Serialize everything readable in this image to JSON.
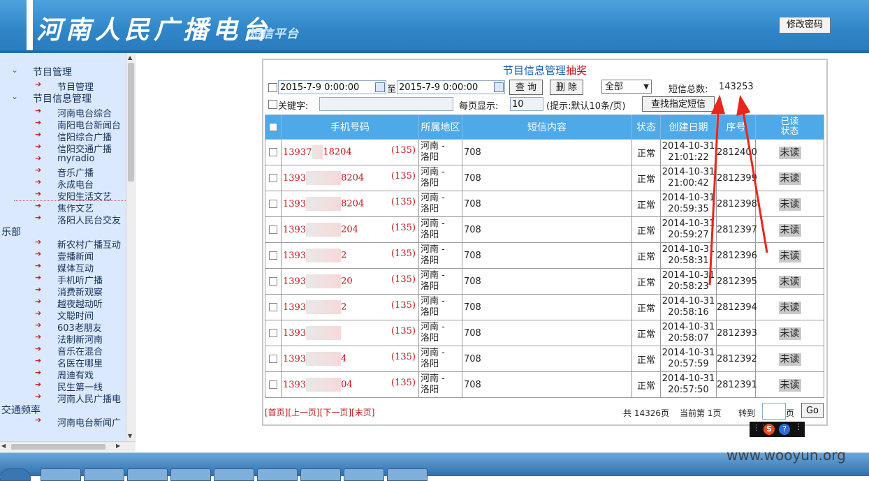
{
  "header": {
    "title": "河南人民广播电台",
    "subtitle": "短信平台",
    "change_password": "修改密码"
  },
  "sidebar": {
    "groups": [
      {
        "label": "节目管理",
        "items": [
          "节目管理"
        ]
      },
      {
        "label": "节目信息管理",
        "items": [
          "河南电台综合",
          "南阳电台新闻台",
          "信阳综合广播",
          "信阳交通广播",
          "myradio",
          "音乐广播",
          "永成电台",
          "安阳生活文艺",
          "焦作文艺",
          "洛阳人民台交友"
        ]
      }
    ],
    "orphan_1": "乐部",
    "items_2": [
      "新农村广播互动",
      "壹播新闻",
      "媒体互动",
      "手机听广播",
      "消费新观察",
      "越夜越动听",
      "文聪时间",
      "603老朋友",
      "法制新河南",
      "音乐在混合",
      "名医在哪里",
      "周迪有戏",
      "民生第一线",
      "河南人民广播电"
    ],
    "orphan_2": "交通频率",
    "items_3": [
      "河南电台新闻广"
    ]
  },
  "panel": {
    "title": "节目信息管理",
    "title_suffix": "抽奖",
    "date_from": "2015-7-9 0:00:00",
    "to_label": "至",
    "date_to": "2015-7-9 0:00:00",
    "query_btn": "查 询",
    "delete_btn": "删 除",
    "status_select": "全部",
    "total_label": "短信总数:",
    "total_value": "143253",
    "keyword_label": "关键字:",
    "keyword_value": "",
    "per_page_label": "每页显示:",
    "per_page_value": "10",
    "hint": "(提示:默认10条/页)",
    "find_btn": "查找指定短信"
  },
  "table": {
    "headers": {
      "phone": "手机号码",
      "region": "所属地区",
      "content": "短信内容",
      "status": "状态",
      "date": "创建日期",
      "seq": "序号",
      "read_1": "已读",
      "read_2": "状态"
    },
    "rows": [
      {
        "phone_a": "13937",
        "phone_b": "18204",
        "op": "(135)",
        "region_1": "河南 -",
        "region_2": "洛阳",
        "content": "708",
        "status": "正常",
        "date_1": "2014-10-31",
        "date_2": "21:01:22",
        "seq": "2812400",
        "read": "未读"
      },
      {
        "phone_a": "1393",
        "phone_b": "8204",
        "op": "(135)",
        "region_1": "河南 -",
        "region_2": "洛阳",
        "content": "708",
        "status": "正常",
        "date_1": "2014-10-31",
        "date_2": "21:00:42",
        "seq": "2812399",
        "read": "未读"
      },
      {
        "phone_a": "1393",
        "phone_b": "8204",
        "op": "(135)",
        "region_1": "河南 -",
        "region_2": "洛阳",
        "content": "708",
        "status": "正常",
        "date_1": "2014-10-31",
        "date_2": "20:59:35",
        "seq": "2812398",
        "read": "未读"
      },
      {
        "phone_a": "1393",
        "phone_b": "204",
        "op": "(135)",
        "region_1": "河南 -",
        "region_2": "洛阳",
        "content": "708",
        "status": "正常",
        "date_1": "2014-10-31",
        "date_2": "20:59:27",
        "seq": "2812397",
        "read": "未读"
      },
      {
        "phone_a": "1393",
        "phone_b": "2",
        "op": "(135)",
        "region_1": "河南 -",
        "region_2": "洛阳",
        "content": "708",
        "status": "正常",
        "date_1": "2014-10-31",
        "date_2": "20:58:31",
        "seq": "2812396",
        "read": "未读"
      },
      {
        "phone_a": "1393",
        "phone_b": "20",
        "op": "(135)",
        "region_1": "河南 -",
        "region_2": "洛阳",
        "content": "708",
        "status": "正常",
        "date_1": "2014-10-31",
        "date_2": "20:58:23",
        "seq": "2812395",
        "read": "未读"
      },
      {
        "phone_a": "1393",
        "phone_b": "2",
        "op": "(135)",
        "region_1": "河南 -",
        "region_2": "洛阳",
        "content": "708",
        "status": "正常",
        "date_1": "2014-10-31",
        "date_2": "20:58:16",
        "seq": "2812394",
        "read": "未读"
      },
      {
        "phone_a": "1393",
        "phone_b": "",
        "op": "(135)",
        "region_1": "河南 -",
        "region_2": "洛阳",
        "content": "708",
        "status": "正常",
        "date_1": "2014-10-31",
        "date_2": "20:58:07",
        "seq": "2812393",
        "read": "未读"
      },
      {
        "phone_a": "1393",
        "phone_b": "4",
        "op": "(135)",
        "region_1": "河南 -",
        "region_2": "洛阳",
        "content": "708",
        "status": "正常",
        "date_1": "2014-10-31",
        "date_2": "20:57:59",
        "seq": "2812392",
        "read": "未读"
      },
      {
        "phone_a": "1393",
        "phone_b": "04",
        "op": "(135)",
        "region_1": "河南 -",
        "region_2": "洛阳",
        "content": "708",
        "status": "正常",
        "date_1": "2014-10-31",
        "date_2": "20:57:50",
        "seq": "2812391",
        "read": "未读"
      }
    ]
  },
  "pager": {
    "first": "[首页]",
    "prev": "[上一页]",
    "next": "[下一页]",
    "last": "[末页]",
    "total_pages": "共 14326页",
    "current": "当前第 1页",
    "goto": "转到",
    "page_unit": "页",
    "go_btn": "Go"
  },
  "watermark": "www.wooyun.org",
  "colors": {
    "header_blue": "#2f86c8",
    "sidebar_bg": "#dbe9ff",
    "table_header": "#4ea9e8",
    "accent_red": "#c0141a"
  }
}
